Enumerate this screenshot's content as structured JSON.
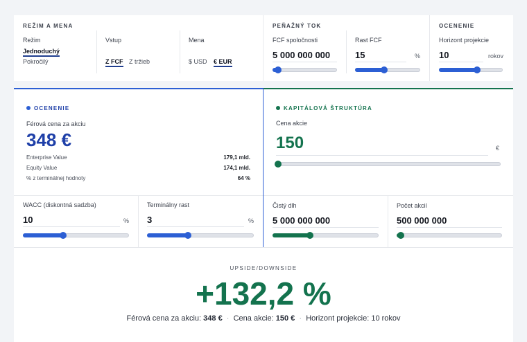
{
  "top": {
    "mode_section": {
      "title": "REŽIM A MENA",
      "mode": {
        "label": "Režim",
        "options": [
          "Jednoduchý",
          "Pokročilý"
        ],
        "selected": "Jednoduchý"
      },
      "input": {
        "label": "Vstup",
        "options": [
          "Z FCF",
          "Z tržieb"
        ],
        "selected": "Z FCF"
      },
      "currency": {
        "label": "Mena",
        "options": [
          "$ USD",
          "€ EUR"
        ],
        "selected": "€ EUR"
      }
    },
    "cashflow_section": {
      "title": "PEŇAŽNÝ TOK",
      "fcf": {
        "label": "FCF spoločnosti",
        "value": "5 000 000 000",
        "slider_fraction": 0.08
      },
      "growth": {
        "label": "Rast FCF",
        "value": "15",
        "unit": "%",
        "slider_fraction": 0.45
      }
    },
    "valuation_section": {
      "title": "OCENENIE",
      "horizon": {
        "label": "Horizont projekcie",
        "value": "10",
        "unit": "rokov",
        "slider_fraction": 0.6
      }
    }
  },
  "valuation": {
    "title": "OCENENIE",
    "fair_label": "Férová cena za akciu",
    "fair_value": "348 €",
    "rows": [
      {
        "label": "Enterprise Value",
        "value": "179,1 mld."
      },
      {
        "label": "Equity Value",
        "value": "174,1 mld."
      },
      {
        "label": "% z terminálnej hodnoty",
        "value": "64 %"
      }
    ],
    "wacc": {
      "label": "WACC (diskontná sadzba)",
      "value": "10",
      "unit": "%",
      "slider_fraction": 0.38
    },
    "terminal": {
      "label": "Terminálny rast",
      "value": "3",
      "unit": "%",
      "slider_fraction": 0.38
    }
  },
  "capital": {
    "title": "KAPITÁLOVÁ ŠTRUKTÚRA",
    "price": {
      "label": "Cena akcie",
      "value": "150",
      "unit": "€",
      "slider_fraction": 0.0
    },
    "debt": {
      "label": "Čistý dlh",
      "value": "5 000 000 000",
      "slider_fraction": 0.35
    },
    "shares": {
      "label": "Počet akcií",
      "value": "500 000 000",
      "slider_fraction": 0.03
    }
  },
  "upside": {
    "title": "UPSIDE/DOWNSIDE",
    "value": "+132,2 %",
    "fair_label": "Férová cena za akciu:",
    "fair_value": "348 €",
    "price_label": "Cena akcie:",
    "price_value": "150 €",
    "horizon_text": "Horizont projekcie: 10 rokov"
  },
  "colors": {
    "blue": "#2c5fd4",
    "green": "#14734e",
    "dark_blue": "#1e3fa8"
  }
}
